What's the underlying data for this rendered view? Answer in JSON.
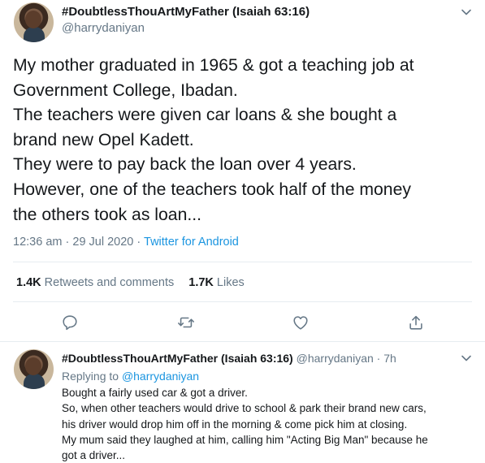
{
  "main_tweet": {
    "display_name": "#DoubtlessThouArtMyFather (Isaiah 63:16)",
    "handle": "@harrydaniyan",
    "lines": [
      "My mother graduated in 1965 & got a teaching job at",
      "Government College, Ibadan.",
      "The teachers were given car loans & she bought a",
      "brand new Opel Kadett.",
      "They were to pay back the loan over 4 years.",
      "However, one of the teachers took half of the money",
      "the others took as loan..."
    ],
    "time": "12:36 am",
    "date": "29 Jul 2020",
    "separator": "·",
    "source": "Twitter for Android",
    "retweets_count": "1.4K",
    "retweets_label": "Retweets and comments",
    "likes_count": "1.7K",
    "likes_label": "Likes"
  },
  "reply_tweet": {
    "display_name": "#DoubtlessThouArtMyFather (Isaiah 63:16)",
    "handle": "@harrydaniyan",
    "separator": "·",
    "age": "7h",
    "replying_prefix": "Replying to",
    "replying_mention": "@harrydaniyan",
    "lines": [
      "Bought a fairly used car & got a driver.",
      "So, when other teachers would drive to school & park their brand new cars,",
      "his driver would drop him off in the morning & come pick him at closing.",
      "My mum said they laughed at him, calling him \"Acting Big Man\" because he",
      "got a driver..."
    ]
  },
  "icons": {
    "menu": "chevron-down-icon",
    "reply": "reply-icon",
    "retweet": "retweet-icon",
    "like": "heart-icon",
    "share": "share-icon"
  },
  "colors": {
    "text": "#14171a",
    "secondary": "#657786",
    "link": "#1b95e0",
    "divider": "#e6ecf0"
  }
}
